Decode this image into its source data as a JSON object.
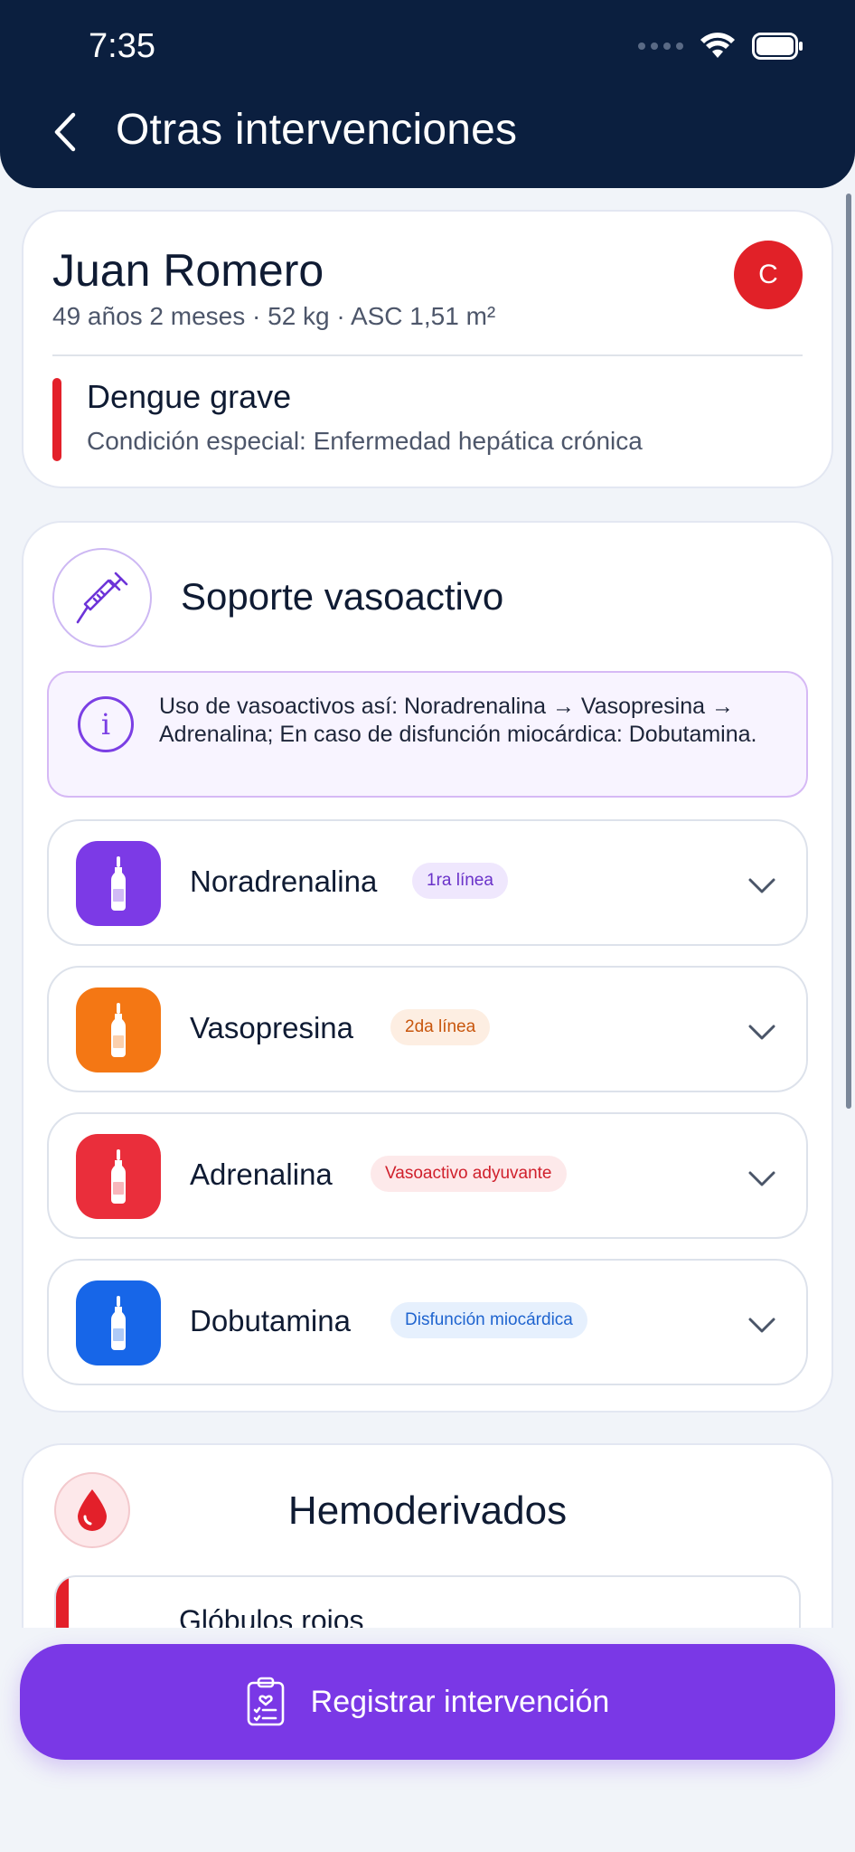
{
  "status_bar": {
    "time": "7:35"
  },
  "header": {
    "title": "Otras intervenciones"
  },
  "patient": {
    "name": "Juan Romero",
    "meta": "49 años 2 meses · 52 kg · ASC 1,51 m²",
    "avatar_letter": "C",
    "diagnosis": "Dengue grave",
    "special_condition": "Condición especial: Enfermedad hepática crónica"
  },
  "vasoactive": {
    "title": "Soporte vasoactivo",
    "info": "Uso de vasoactivos así: Noradrenalina → Vasopresina → Adrenalina; En caso de disfunción miocárdica: Dobutamina.",
    "drugs": [
      {
        "name": "Noradrenalina",
        "badge": "1ra línea",
        "color": "#7c3ae6",
        "badge_bg": "#efe7fd",
        "badge_fg": "#6a32c9"
      },
      {
        "name": "Vasopresina",
        "badge": "2da línea",
        "color": "#f47714",
        "badge_bg": "#fdeee2",
        "badge_fg": "#c8560d"
      },
      {
        "name": "Adrenalina",
        "badge": "Vasoactivo adyuvante",
        "color": "#ea2e3b",
        "badge_bg": "#fde9ea",
        "badge_fg": "#d0202c"
      },
      {
        "name": "Dobutamina",
        "badge": "Disfunción miocárdica",
        "color": "#1766e8",
        "badge_bg": "#e6f0fd",
        "badge_fg": "#1f64cf"
      }
    ]
  },
  "blood_products": {
    "title": "Hemoderivados",
    "items": [
      {
        "name": "Glóbulos rojos"
      }
    ]
  },
  "action": {
    "label": "Registrar intervención"
  },
  "icons": {
    "back": "back-arrow-icon",
    "syringe": "syringe-icon",
    "info": "info-icon",
    "ampoule": "ampoule-icon",
    "chevron": "chevron-down-icon",
    "blood_drop": "blood-drop-icon",
    "clipboard": "clipboard-icon"
  }
}
